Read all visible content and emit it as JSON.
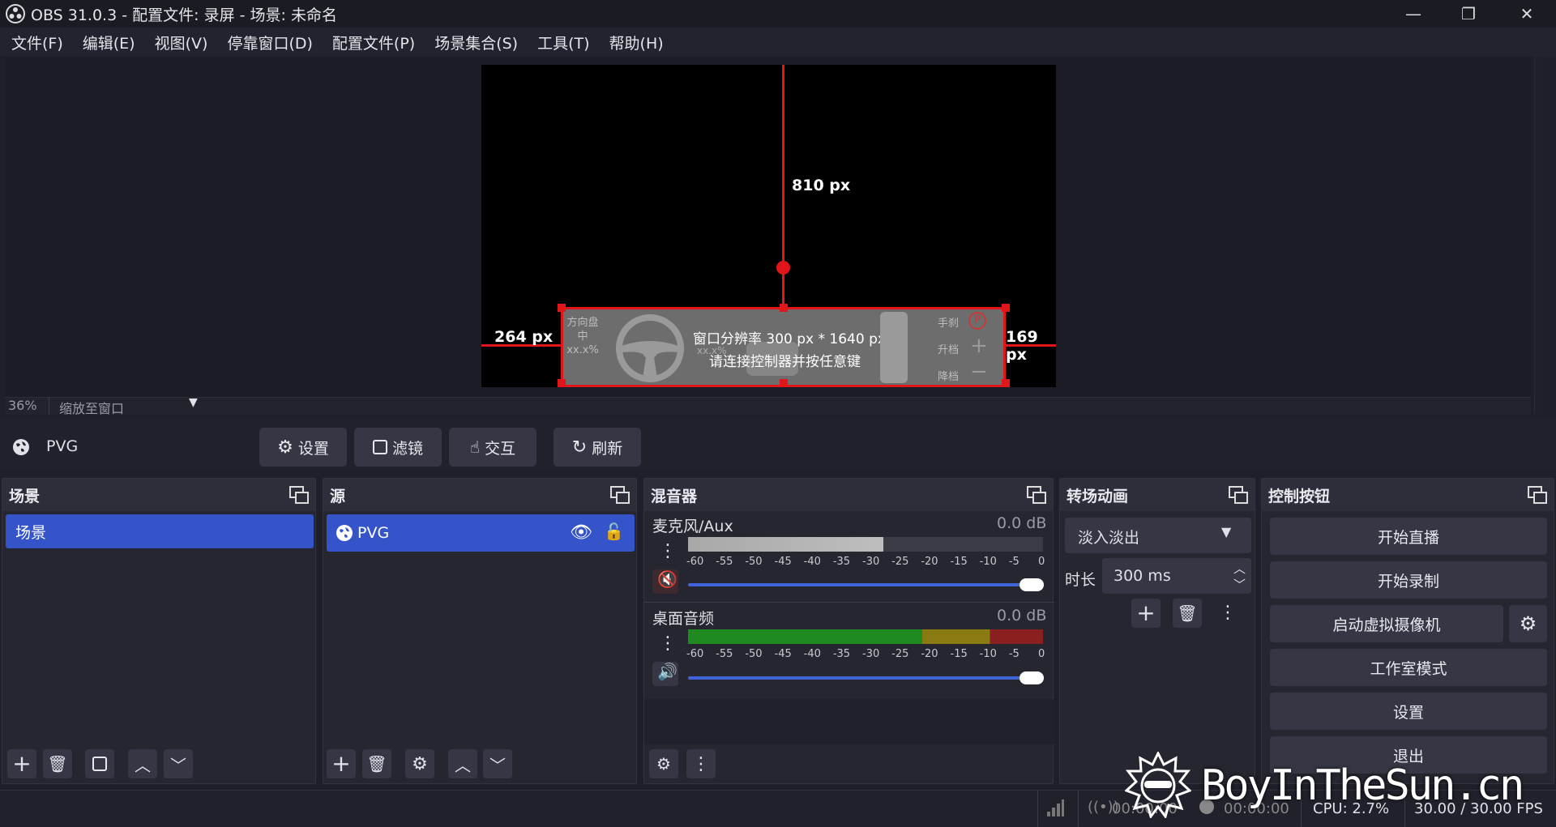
{
  "window": {
    "title": "OBS 31.0.3 - 配置文件: 录屏 - 场景: 未命名",
    "controls": {
      "minimize": "—",
      "restore": "❐",
      "close": "✕"
    }
  },
  "menu": [
    "文件(F)",
    "编辑(E)",
    "视图(V)",
    "停靠窗口(D)",
    "配置文件(P)",
    "场景集合(S)",
    "工具(T)",
    "帮助(H)"
  ],
  "preview": {
    "top_measure": "810 px",
    "left_measure": "264 px",
    "right_measure": "169 px",
    "overlay": {
      "steering_label": "方向盘",
      "steering_state": "中",
      "steering_value": "xx.x%",
      "resolution_text": "窗口分辨率 300 px * 1640 px",
      "prompt_text": "请连接控制器并按任意键",
      "small_value": "xx.x%",
      "handbrake": "手刹",
      "handbrake_icon": "P",
      "shift_up": "升档",
      "shift_down": "降档"
    },
    "zoom_percent": "36%",
    "zoom_mode": "缩放至窗口"
  },
  "source_toolbar": {
    "source_name": "PVG",
    "buttons": [
      "设置",
      "滤镜",
      "交互",
      "刷新"
    ]
  },
  "scenes": {
    "title": "场景",
    "items": [
      "场景"
    ]
  },
  "sources": {
    "title": "源",
    "items": [
      "PVG"
    ]
  },
  "mixer": {
    "title": "混音器",
    "channels": [
      {
        "name": "麦克风/Aux",
        "db": "0.0 dB",
        "muted": true,
        "level": 0.55
      },
      {
        "name": "桌面音频",
        "db": "0.0 dB",
        "muted": false,
        "level": 1.0
      }
    ],
    "scale": [
      "-60",
      "-55",
      "-50",
      "-45",
      "-40",
      "-35",
      "-30",
      "-25",
      "-20",
      "-15",
      "-10",
      "-5",
      "0"
    ]
  },
  "transitions": {
    "title": "转场动画",
    "selected": "淡入淡出",
    "duration_label": "时长",
    "duration_value": "300 ms"
  },
  "controls": {
    "title": "控制按钮",
    "buttons": [
      "开始直播",
      "开始录制",
      "启动虚拟摄像机",
      "工作室模式",
      "设置",
      "退出"
    ]
  },
  "statusbar": {
    "stream_time": "00:00:00",
    "record_time": "00:00:00",
    "cpu": "CPU: 2.7%",
    "fps": "30.00 / 30.00 FPS"
  },
  "watermark": "BoyInTheSun.cn",
  "colors": {
    "accent": "#3554c9",
    "selection_red": "#e0161b",
    "meter_green": "#1f8a1f",
    "meter_yellow": "#8a7a12",
    "meter_red": "#8a1f1f"
  }
}
